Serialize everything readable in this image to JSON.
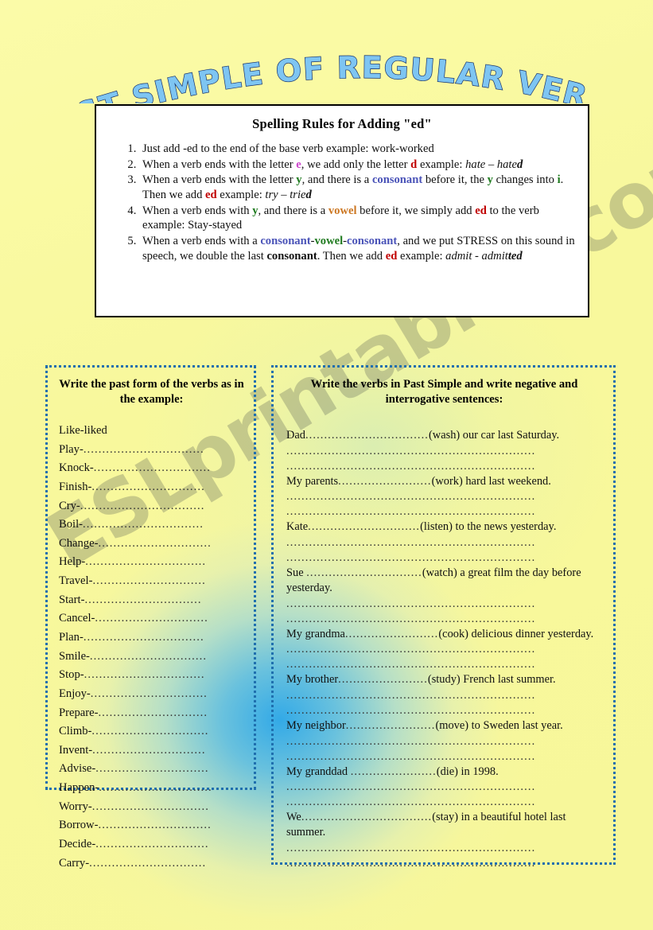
{
  "title": "PAST SIMPLE OF REGULAR VERBS",
  "watermark": "ESLprintables.com",
  "colors": {
    "page_background": "#f9f9a0",
    "glow_blue": "#28a5eb",
    "title_fill": "#7ec5f2",
    "title_outline": "#16306a",
    "box_border_blue": "#1f6fae",
    "rules_border": "#000000",
    "letter_e": "#cc44cc",
    "letter_d": "#c00000",
    "letter_y": "#1f7a1f",
    "letter_i": "#1f7a1f",
    "ed": "#c00000",
    "consonant": "#4a53b8",
    "vowel_orange": "#cc7722",
    "vowel_green": "#1f7a1f"
  },
  "rules": {
    "heading": "Spelling Rules for Adding \"ed\"",
    "items": [
      {
        "number": "1.",
        "parts": [
          {
            "t": "Just add  -ed to the end of the base verb example: work-worked",
            "s": "plain"
          }
        ]
      },
      {
        "number": "2.",
        "parts": [
          {
            "t": "When a verb ends with the letter ",
            "s": "plain"
          },
          {
            "t": "e",
            "s": "e"
          },
          {
            "t": ", we add only the letter ",
            "s": "plain"
          },
          {
            "t": "d",
            "s": "d"
          },
          {
            "t": " example:   ",
            "s": "plain"
          },
          {
            "t": "hate",
            "s": "ital"
          },
          {
            "t": " – ",
            "s": "plain"
          },
          {
            "t": "hate",
            "s": "ital"
          },
          {
            "t": "d",
            "s": "ital-bold"
          }
        ]
      },
      {
        "number": "3.",
        "parts": [
          {
            "t": "When a verb ends with the letter ",
            "s": "plain"
          },
          {
            "t": "y",
            "s": "y"
          },
          {
            "t": ", and there is a ",
            "s": "plain"
          },
          {
            "t": "consonant",
            "s": "cons"
          },
          {
            "t": " before it, the ",
            "s": "plain"
          },
          {
            "t": "y",
            "s": "y"
          },
          {
            "t": " changes into ",
            "s": "plain"
          },
          {
            "t": "i",
            "s": "i"
          },
          {
            "t": ". Then we add ",
            "s": "plain"
          },
          {
            "t": "ed",
            "s": "ed"
          },
          {
            "t": "  example:    ",
            "s": "plain"
          },
          {
            "t": "try – trie",
            "s": "ital"
          },
          {
            "t": "d",
            "s": "ital-bold"
          }
        ]
      },
      {
        "number": "4.",
        "parts": [
          {
            "t": "When a verb ends with ",
            "s": "plain"
          },
          {
            "t": "y",
            "s": "y"
          },
          {
            "t": ", and there is a ",
            "s": "plain"
          },
          {
            "t": "vowel",
            "s": "vowel-o"
          },
          {
            "t": " before it, we simply add ",
            "s": "plain"
          },
          {
            "t": "ed",
            "s": "ed"
          },
          {
            "t": " to the verb  example:   Stay-stayed",
            "s": "plain"
          }
        ]
      },
      {
        "number": "5.",
        "parts": [
          {
            "t": "When a verb ends with a ",
            "s": "plain"
          },
          {
            "t": "consonant",
            "s": "cons"
          },
          {
            "t": "-",
            "s": "plain"
          },
          {
            "t": "vowel",
            "s": "vowel-g"
          },
          {
            "t": "-",
            "s": "plain"
          },
          {
            "t": "consonant",
            "s": "cons"
          },
          {
            "t": ", and we put STRESS on this sound in speech, we double the last ",
            "s": "plain"
          },
          {
            "t": "consonant",
            "s": "bold"
          },
          {
            "t": ". Then we add ",
            "s": "plain"
          },
          {
            "t": "ed",
            "s": "ed"
          },
          {
            "t": "  example: ",
            "s": "plain"
          },
          {
            "t": "admit -  admit",
            "s": "ital"
          },
          {
            "t": "ted",
            "s": "ital-bold"
          }
        ]
      }
    ]
  },
  "left_exercise": {
    "heading": "Write the past form of the verbs as in the example:",
    "example": "Like-liked",
    "verbs": [
      "Play-",
      "Knock-",
      "Finish-",
      "Cry-",
      "Boil-",
      "Change-",
      "Help-",
      "Travel-",
      "Start-",
      "Cancel-",
      "Plan-",
      "Smile-",
      "Stop-",
      "Enjoy-",
      "Prepare-",
      "Climb-",
      "Invent-",
      "Advise-",
      "Happen-",
      "Worry-",
      "Borrow-",
      "Decide-",
      "Carry-"
    ]
  },
  "right_exercise": {
    "heading": "Write the verbs in Past Simple and write negative and interrogative sentences:",
    "sentences": [
      {
        "subject": "Dad",
        "verb": "(wash)",
        "rest": "our car last Saturday."
      },
      {
        "subject": "My parents",
        "verb": "(work)",
        "rest": "hard last weekend."
      },
      {
        "subject": "Kate",
        "verb": "(listen)",
        "rest": "to the news yesterday."
      },
      {
        "subject": "Sue ",
        "verb": "(watch)",
        "rest": "a great film the day before yesterday."
      },
      {
        "subject": "My grandma",
        "verb": "(cook)",
        "rest": "delicious dinner yesterday."
      },
      {
        "subject": "My brother",
        "verb": "(study)",
        "rest": "French last summer."
      },
      {
        "subject": "My neighbor",
        "verb": "(move)",
        "rest": "to Sweden last year."
      },
      {
        "subject": "My granddad ",
        "verb": "(die)",
        "rest": "in 1998."
      },
      {
        "subject": "We",
        "verb": "(stay)",
        "rest": "in a beautiful hotel last summer."
      }
    ],
    "answer_lines_per_sentence": 2
  }
}
